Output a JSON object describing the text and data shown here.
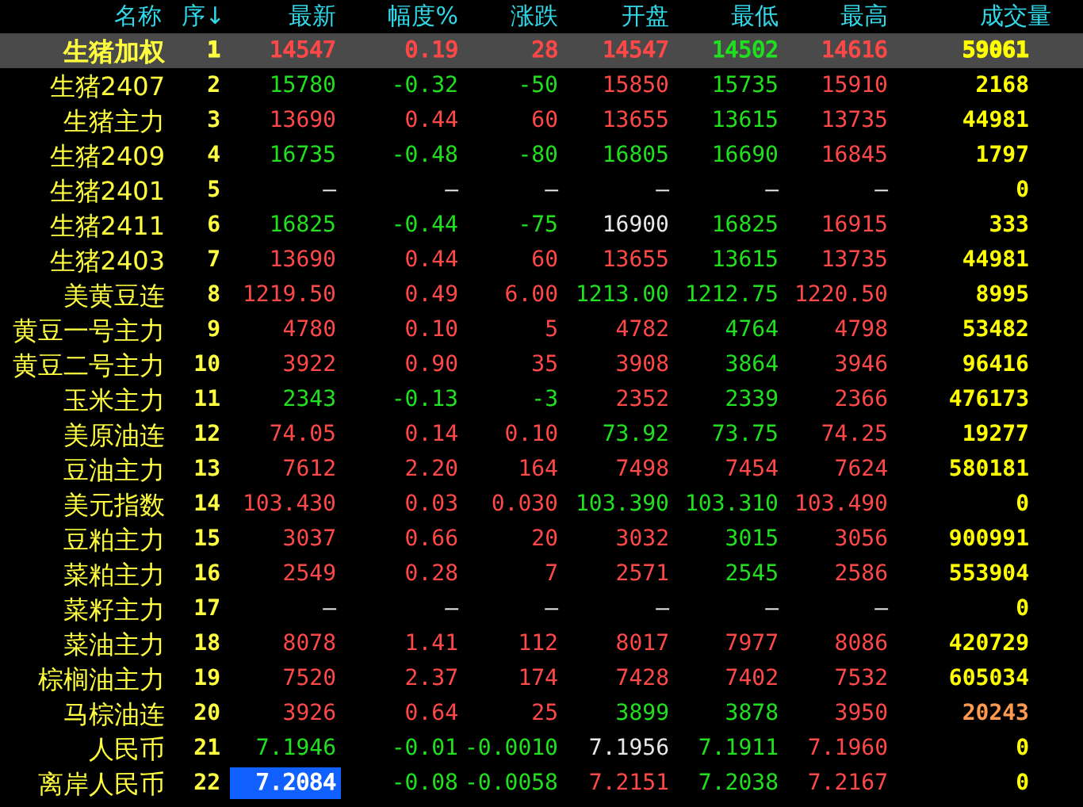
{
  "columns": [
    "名称",
    "序↓",
    "最新",
    "幅度%",
    "涨跌",
    "开盘",
    "最低",
    "最高",
    "成交量"
  ],
  "rows": [
    {
      "name": "生猪加权",
      "index": "1",
      "selected": true,
      "cells": [
        {
          "text": "14547",
          "color": "#ff4848",
          "focused": false
        },
        {
          "text": "0.19",
          "color": "#ff4848"
        },
        {
          "text": "28",
          "color": "#ff4848"
        },
        {
          "text": "14547",
          "color": "#ff4848"
        },
        {
          "text": "14502",
          "color": "#20e020"
        },
        {
          "text": "14616",
          "color": "#ff4848"
        }
      ],
      "volume": {
        "text": "59061",
        "color": "#ffff00"
      }
    },
    {
      "name": "生猪2407",
      "index": "2",
      "selected": false,
      "cells": [
        {
          "text": "15780",
          "color": "#20e020",
          "focused": false
        },
        {
          "text": "-0.32",
          "color": "#20e020"
        },
        {
          "text": "-50",
          "color": "#20e020"
        },
        {
          "text": "15850",
          "color": "#ff4848"
        },
        {
          "text": "15735",
          "color": "#20e020"
        },
        {
          "text": "15910",
          "color": "#ff4848"
        }
      ],
      "volume": {
        "text": "2168",
        "color": "#ffff00"
      }
    },
    {
      "name": "生猪主力",
      "index": "3",
      "selected": false,
      "cells": [
        {
          "text": "13690",
          "color": "#ff4848",
          "focused": false
        },
        {
          "text": "0.44",
          "color": "#ff4848"
        },
        {
          "text": "60",
          "color": "#ff4848"
        },
        {
          "text": "13655",
          "color": "#ff4848"
        },
        {
          "text": "13615",
          "color": "#20e020"
        },
        {
          "text": "13735",
          "color": "#ff4848"
        }
      ],
      "volume": {
        "text": "44981",
        "color": "#ffff00"
      }
    },
    {
      "name": "生猪2409",
      "index": "4",
      "selected": false,
      "cells": [
        {
          "text": "16735",
          "color": "#20e020",
          "focused": false
        },
        {
          "text": "-0.48",
          "color": "#20e020"
        },
        {
          "text": "-80",
          "color": "#20e020"
        },
        {
          "text": "16805",
          "color": "#20e020"
        },
        {
          "text": "16690",
          "color": "#20e020"
        },
        {
          "text": "16845",
          "color": "#ff4848"
        }
      ],
      "volume": {
        "text": "1797",
        "color": "#ffff00"
      }
    },
    {
      "name": "生猪2401",
      "index": "5",
      "selected": false,
      "cells": [
        {
          "text": "—",
          "color": "#e8e8e8",
          "focused": false
        },
        {
          "text": "—",
          "color": "#e8e8e8"
        },
        {
          "text": "—",
          "color": "#e8e8e8"
        },
        {
          "text": "—",
          "color": "#e8e8e8"
        },
        {
          "text": "—",
          "color": "#e8e8e8"
        },
        {
          "text": "—",
          "color": "#e8e8e8"
        }
      ],
      "volume": {
        "text": "0",
        "color": "#ffff00"
      }
    },
    {
      "name": "生猪2411",
      "index": "6",
      "selected": false,
      "cells": [
        {
          "text": "16825",
          "color": "#20e020",
          "focused": false
        },
        {
          "text": "-0.44",
          "color": "#20e020"
        },
        {
          "text": "-75",
          "color": "#20e020"
        },
        {
          "text": "16900",
          "color": "#e8e8e8"
        },
        {
          "text": "16825",
          "color": "#20e020"
        },
        {
          "text": "16915",
          "color": "#ff4848"
        }
      ],
      "volume": {
        "text": "333",
        "color": "#ffff00"
      }
    },
    {
      "name": "生猪2403",
      "index": "7",
      "selected": false,
      "cells": [
        {
          "text": "13690",
          "color": "#ff4848",
          "focused": false
        },
        {
          "text": "0.44",
          "color": "#ff4848"
        },
        {
          "text": "60",
          "color": "#ff4848"
        },
        {
          "text": "13655",
          "color": "#ff4848"
        },
        {
          "text": "13615",
          "color": "#20e020"
        },
        {
          "text": "13735",
          "color": "#ff4848"
        }
      ],
      "volume": {
        "text": "44981",
        "color": "#ffff00"
      }
    },
    {
      "name": "美黄豆连",
      "index": "8",
      "selected": false,
      "cells": [
        {
          "text": "1219.50",
          "color": "#ff4848",
          "focused": false
        },
        {
          "text": "0.49",
          "color": "#ff4848"
        },
        {
          "text": "6.00",
          "color": "#ff4848"
        },
        {
          "text": "1213.00",
          "color": "#20e020"
        },
        {
          "text": "1212.75",
          "color": "#20e020"
        },
        {
          "text": "1220.50",
          "color": "#ff4848"
        }
      ],
      "volume": {
        "text": "8995",
        "color": "#ffff00"
      }
    },
    {
      "name": "黄豆一号主力",
      "index": "9",
      "selected": false,
      "cells": [
        {
          "text": "4780",
          "color": "#ff4848",
          "focused": false
        },
        {
          "text": "0.10",
          "color": "#ff4848"
        },
        {
          "text": "5",
          "color": "#ff4848"
        },
        {
          "text": "4782",
          "color": "#ff4848"
        },
        {
          "text": "4764",
          "color": "#20e020"
        },
        {
          "text": "4798",
          "color": "#ff4848"
        }
      ],
      "volume": {
        "text": "53482",
        "color": "#ffff00"
      }
    },
    {
      "name": "黄豆二号主力",
      "index": "10",
      "selected": false,
      "cells": [
        {
          "text": "3922",
          "color": "#ff4848",
          "focused": false
        },
        {
          "text": "0.90",
          "color": "#ff4848"
        },
        {
          "text": "35",
          "color": "#ff4848"
        },
        {
          "text": "3908",
          "color": "#ff4848"
        },
        {
          "text": "3864",
          "color": "#20e020"
        },
        {
          "text": "3946",
          "color": "#ff4848"
        }
      ],
      "volume": {
        "text": "96416",
        "color": "#ffff00"
      }
    },
    {
      "name": "玉米主力",
      "index": "11",
      "selected": false,
      "cells": [
        {
          "text": "2343",
          "color": "#20e020",
          "focused": false
        },
        {
          "text": "-0.13",
          "color": "#20e020"
        },
        {
          "text": "-3",
          "color": "#20e020"
        },
        {
          "text": "2352",
          "color": "#ff4848"
        },
        {
          "text": "2339",
          "color": "#20e020"
        },
        {
          "text": "2366",
          "color": "#ff4848"
        }
      ],
      "volume": {
        "text": "476173",
        "color": "#ffff00"
      }
    },
    {
      "name": "美原油连",
      "index": "12",
      "selected": false,
      "cells": [
        {
          "text": "74.05",
          "color": "#ff4848",
          "focused": false
        },
        {
          "text": "0.14",
          "color": "#ff4848"
        },
        {
          "text": "0.10",
          "color": "#ff4848"
        },
        {
          "text": "73.92",
          "color": "#20e020"
        },
        {
          "text": "73.75",
          "color": "#20e020"
        },
        {
          "text": "74.25",
          "color": "#ff4848"
        }
      ],
      "volume": {
        "text": "19277",
        "color": "#ffff00"
      }
    },
    {
      "name": "豆油主力",
      "index": "13",
      "selected": false,
      "cells": [
        {
          "text": "7612",
          "color": "#ff4848",
          "focused": false
        },
        {
          "text": "2.20",
          "color": "#ff4848"
        },
        {
          "text": "164",
          "color": "#ff4848"
        },
        {
          "text": "7498",
          "color": "#ff4848"
        },
        {
          "text": "7454",
          "color": "#ff4848"
        },
        {
          "text": "7624",
          "color": "#ff4848"
        }
      ],
      "volume": {
        "text": "580181",
        "color": "#ffff00"
      }
    },
    {
      "name": "美元指数",
      "index": "14",
      "selected": false,
      "cells": [
        {
          "text": "103.430",
          "color": "#ff4848",
          "focused": false
        },
        {
          "text": "0.03",
          "color": "#ff4848"
        },
        {
          "text": "0.030",
          "color": "#ff4848"
        },
        {
          "text": "103.390",
          "color": "#20e020"
        },
        {
          "text": "103.310",
          "color": "#20e020"
        },
        {
          "text": "103.490",
          "color": "#ff4848"
        }
      ],
      "volume": {
        "text": "0",
        "color": "#ffff00"
      }
    },
    {
      "name": "豆粕主力",
      "index": "15",
      "selected": false,
      "cells": [
        {
          "text": "3037",
          "color": "#ff4848",
          "focused": false
        },
        {
          "text": "0.66",
          "color": "#ff4848"
        },
        {
          "text": "20",
          "color": "#ff4848"
        },
        {
          "text": "3032",
          "color": "#ff4848"
        },
        {
          "text": "3015",
          "color": "#20e020"
        },
        {
          "text": "3056",
          "color": "#ff4848"
        }
      ],
      "volume": {
        "text": "900991",
        "color": "#ffff00"
      }
    },
    {
      "name": "菜粕主力",
      "index": "16",
      "selected": false,
      "cells": [
        {
          "text": "2549",
          "color": "#ff4848",
          "focused": false
        },
        {
          "text": "0.28",
          "color": "#ff4848"
        },
        {
          "text": "7",
          "color": "#ff4848"
        },
        {
          "text": "2571",
          "color": "#ff4848"
        },
        {
          "text": "2545",
          "color": "#20e020"
        },
        {
          "text": "2586",
          "color": "#ff4848"
        }
      ],
      "volume": {
        "text": "553904",
        "color": "#ffff00"
      }
    },
    {
      "name": "菜籽主力",
      "index": "17",
      "selected": false,
      "cells": [
        {
          "text": "—",
          "color": "#e8e8e8",
          "focused": false
        },
        {
          "text": "—",
          "color": "#e8e8e8"
        },
        {
          "text": "—",
          "color": "#e8e8e8"
        },
        {
          "text": "—",
          "color": "#e8e8e8"
        },
        {
          "text": "—",
          "color": "#e8e8e8"
        },
        {
          "text": "—",
          "color": "#e8e8e8"
        }
      ],
      "volume": {
        "text": "0",
        "color": "#ffff00"
      }
    },
    {
      "name": "菜油主力",
      "index": "18",
      "selected": false,
      "cells": [
        {
          "text": "8078",
          "color": "#ff4848",
          "focused": false
        },
        {
          "text": "1.41",
          "color": "#ff4848"
        },
        {
          "text": "112",
          "color": "#ff4848"
        },
        {
          "text": "8017",
          "color": "#ff4848"
        },
        {
          "text": "7977",
          "color": "#ff4848"
        },
        {
          "text": "8086",
          "color": "#ff4848"
        }
      ],
      "volume": {
        "text": "420729",
        "color": "#ffff00"
      }
    },
    {
      "name": "棕榈油主力",
      "index": "19",
      "selected": false,
      "cells": [
        {
          "text": "7520",
          "color": "#ff4848",
          "focused": false
        },
        {
          "text": "2.37",
          "color": "#ff4848"
        },
        {
          "text": "174",
          "color": "#ff4848"
        },
        {
          "text": "7428",
          "color": "#ff4848"
        },
        {
          "text": "7402",
          "color": "#ff4848"
        },
        {
          "text": "7532",
          "color": "#ff4848"
        }
      ],
      "volume": {
        "text": "605034",
        "color": "#ffff00"
      }
    },
    {
      "name": "马棕油连",
      "index": "20",
      "selected": false,
      "cells": [
        {
          "text": "3926",
          "color": "#ff4848",
          "focused": false
        },
        {
          "text": "0.64",
          "color": "#ff4848"
        },
        {
          "text": "25",
          "color": "#ff4848"
        },
        {
          "text": "3899",
          "color": "#20e020"
        },
        {
          "text": "3878",
          "color": "#20e020"
        },
        {
          "text": "3950",
          "color": "#ff4848"
        }
      ],
      "volume": {
        "text": "20243",
        "color": "#ff9a50"
      }
    },
    {
      "name": "人民币",
      "index": "21",
      "selected": false,
      "cells": [
        {
          "text": "7.1946",
          "color": "#20e020",
          "focused": false
        },
        {
          "text": "-0.01",
          "color": "#20e020"
        },
        {
          "text": "-0.0010",
          "color": "#20e020"
        },
        {
          "text": "7.1956",
          "color": "#e8e8e8"
        },
        {
          "text": "7.1911",
          "color": "#20e020"
        },
        {
          "text": "7.1960",
          "color": "#ff4848"
        }
      ],
      "volume": {
        "text": "0",
        "color": "#ffff00"
      }
    },
    {
      "name": "离岸人民币",
      "index": "22",
      "selected": false,
      "cells": [
        {
          "text": "7.2084",
          "color": "#ffffff",
          "focused": true
        },
        {
          "text": "-0.08",
          "color": "#20e020"
        },
        {
          "text": "-0.0058",
          "color": "#20e020"
        },
        {
          "text": "7.2151",
          "color": "#ff4848"
        },
        {
          "text": "7.2038",
          "color": "#20e020"
        },
        {
          "text": "7.2167",
          "color": "#ff4848"
        }
      ],
      "volume": {
        "text": "0",
        "color": "#ffff00"
      }
    }
  ]
}
